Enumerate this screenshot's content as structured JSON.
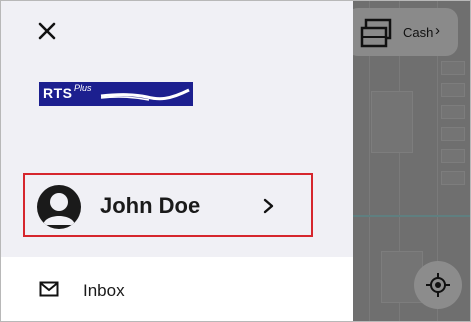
{
  "header": {
    "close_icon": "close-icon",
    "logo": {
      "text": "RTS",
      "superscript": "Plus",
      "color": "#1c1f8f"
    }
  },
  "profile": {
    "name": "John Doe",
    "avatar_icon": "person-icon",
    "chevron_icon": "chevron-right-icon",
    "highlight_color": "#d6262d"
  },
  "menu": {
    "items": [
      {
        "label": "Inbox",
        "icon": "mail-icon"
      }
    ]
  },
  "map_overlay": {
    "payment": {
      "label": "Cash",
      "chevron": "›",
      "icon": "payment-card-icon"
    },
    "locate_icon": "locate-icon"
  }
}
